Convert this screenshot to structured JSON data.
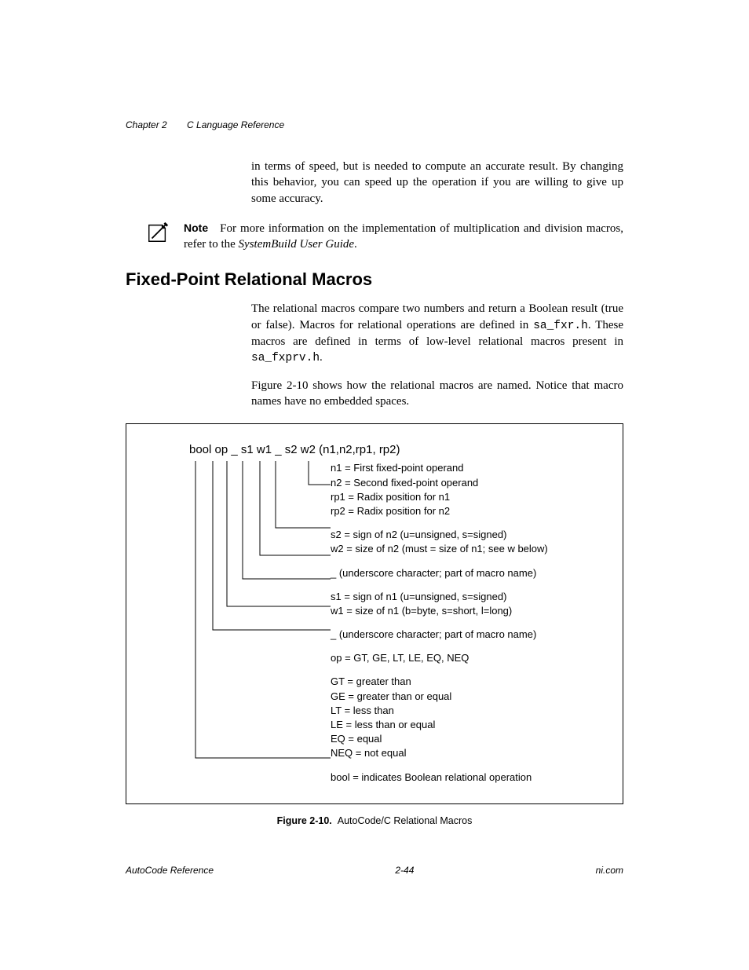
{
  "running_head": {
    "chapter": "Chapter 2",
    "title": "C Language Reference"
  },
  "intro_para": "in terms of speed, but is needed to compute an accurate result. By changing this behavior, you can speed up the operation if you are willing to give up some accuracy.",
  "note": {
    "label": "Note",
    "before_italic": "For more information on the implementation of multiplication and division macros, refer to the ",
    "italic": "SystemBuild User Guide",
    "after_italic": "."
  },
  "section_title": "Fixed-Point Relational Macros",
  "section_body": {
    "p1_a": "The relational macros compare two numbers and return a Boolean result (true or false). Macros for relational operations are defined in ",
    "p1_code1": "sa_fxr.h",
    "p1_b": ". These macros are defined in terms of low-level relational macros present in ",
    "p1_code2": "sa_fxprv.h",
    "p1_c": ".",
    "p2": "Figure 2-10 shows how the relational macros are named. Notice that macro names have no embedded spaces."
  },
  "figure": {
    "signature": "bool op _ s1 w1 _ s2 w2 (n1,n2,rp1, rp2)",
    "groups": [
      {
        "lines": [
          "n1 = First fixed-point operand",
          "n2 = Second fixed-point operand",
          "rp1 = Radix position for n1",
          "rp2 = Radix position for n2"
        ]
      },
      {
        "lines": [
          "s2 = sign of n2 (u=unsigned, s=signed)",
          "w2 = size of n2 (must = size of n1; see w below)"
        ]
      },
      {
        "lines": [
          "_ (underscore character; part of macro name)"
        ]
      },
      {
        "lines": [
          "s1 = sign of n1 (u=unsigned, s=signed)",
          "w1 = size of n1 (b=byte, s=short, l=long)"
        ]
      },
      {
        "lines": [
          "_ (underscore character; part of macro name)"
        ]
      },
      {
        "lines": [
          "op = GT, GE, LT, LE, EQ, NEQ"
        ]
      },
      {
        "lines": [
          "GT = greater than",
          "GE = greater than or equal",
          "LT = less than",
          "LE = less than or equal",
          "EQ = equal",
          "NEQ = not equal"
        ]
      },
      {
        "lines": [
          "bool = indicates Boolean relational operation"
        ]
      }
    ],
    "caption_label": "Figure 2-10.",
    "caption_text": "AutoCode/C Relational Macros"
  },
  "footer": {
    "left": "AutoCode Reference",
    "center": "2-44",
    "right": "ni.com"
  }
}
